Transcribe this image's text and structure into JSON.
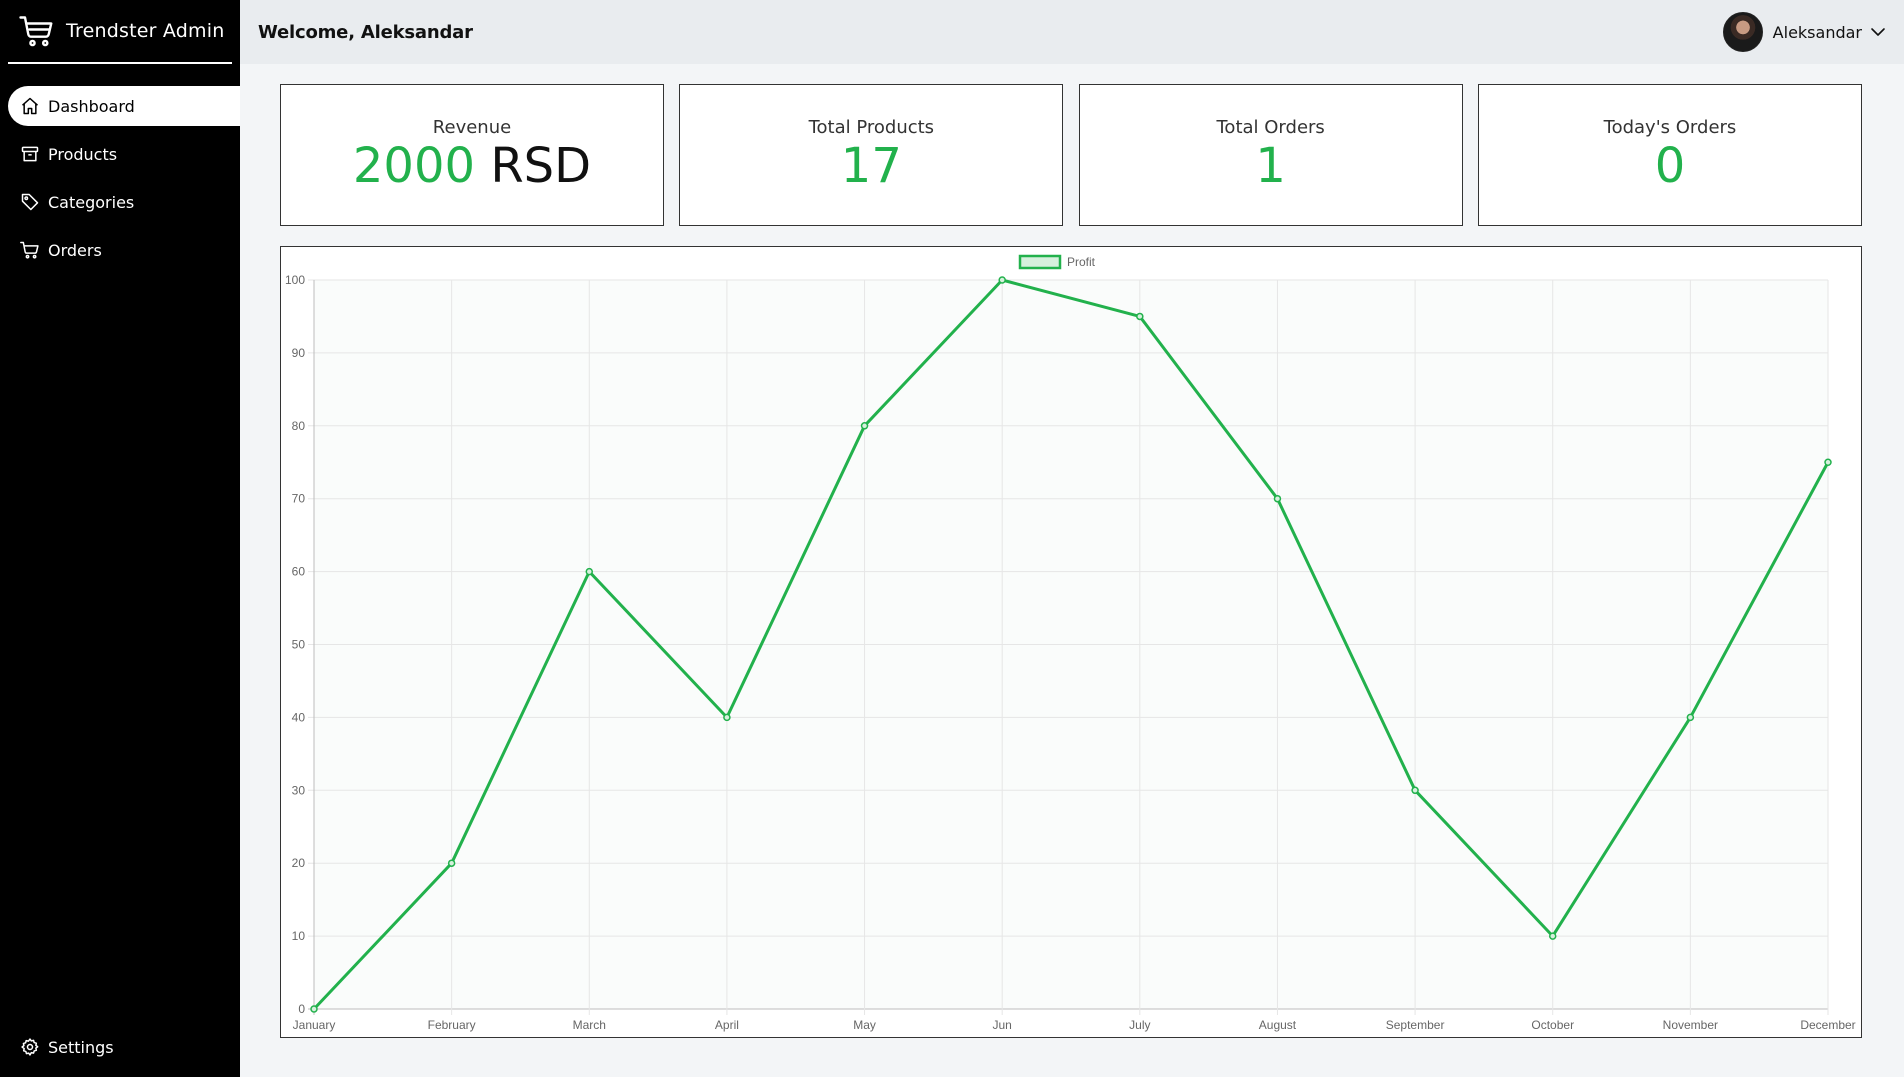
{
  "sidebar": {
    "brand": "Trendster Admin",
    "brand_icon": "cart-icon",
    "items": [
      {
        "label": "Dashboard",
        "icon": "home-icon",
        "active": true
      },
      {
        "label": "Products",
        "icon": "archive-icon",
        "active": false
      },
      {
        "label": "Categories",
        "icon": "tag-icon",
        "active": false
      },
      {
        "label": "Orders",
        "icon": "cart-icon",
        "active": false
      }
    ],
    "settings": {
      "label": "Settings",
      "icon": "gear-icon"
    }
  },
  "header": {
    "welcome": "Welcome, Aleksandar",
    "user_name": "Aleksandar",
    "dropdown_icon": "chevron-down-icon"
  },
  "cards": [
    {
      "label": "Revenue",
      "value": "2000",
      "unit": "RSD"
    },
    {
      "label": "Total Products",
      "value": "17",
      "unit": ""
    },
    {
      "label": "Total Orders",
      "value": "1",
      "unit": ""
    },
    {
      "label": "Today's Orders",
      "value": "0",
      "unit": ""
    }
  ],
  "colors": {
    "accent": "#22b14c",
    "sidebar_bg": "#000000",
    "header_bg": "#e9ecef"
  },
  "chart_data": {
    "type": "line",
    "categories": [
      "January",
      "February",
      "March",
      "April",
      "May",
      "Jun",
      "July",
      "August",
      "September",
      "October",
      "November",
      "December"
    ],
    "series": [
      {
        "name": "Profit",
        "values": [
          0,
          20,
          60,
          40,
          80,
          100,
          95,
          70,
          30,
          10,
          40,
          75
        ],
        "color": "#22b14c"
      }
    ],
    "ylim": [
      0,
      100
    ],
    "yticks": [
      0,
      10,
      20,
      30,
      40,
      50,
      60,
      70,
      80,
      90,
      100
    ],
    "grid": true,
    "legend": "top-center"
  }
}
